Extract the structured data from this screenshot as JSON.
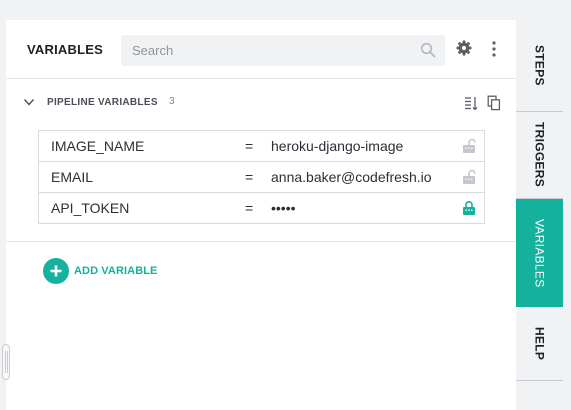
{
  "header": {
    "title": "VARIABLES",
    "search_placeholder": "Search"
  },
  "section": {
    "label": "PIPELINE VARIABLES",
    "count": "3"
  },
  "variables": [
    {
      "name": "IMAGE_NAME",
      "eq": "=",
      "value": "heroku-django-image",
      "locked": false
    },
    {
      "name": "EMAIL",
      "eq": "=",
      "value": "anna.baker@codefresh.io",
      "locked": false
    },
    {
      "name": "API_TOKEN",
      "eq": "=",
      "value": "•••••",
      "locked": true
    }
  ],
  "add_variable_label": "ADD VARIABLE",
  "tabs": [
    {
      "label": "STEPS",
      "active": false
    },
    {
      "label": "TRIGGERS",
      "active": false
    },
    {
      "label": "VARIABLES",
      "active": true
    },
    {
      "label": "HELP",
      "active": false
    }
  ],
  "icons": {
    "search": "search-icon",
    "settings": "gear-icon",
    "more": "kebab-menu-icon",
    "collapse": "chevron-down-icon",
    "sort": "sort-icon",
    "copy": "copy-icon",
    "unlocked": "unlock-icon",
    "locked": "lock-icon",
    "add": "plus-icon"
  },
  "colors": {
    "accent": "#14b29d",
    "lock_unlocked": "#c4c7cc"
  }
}
